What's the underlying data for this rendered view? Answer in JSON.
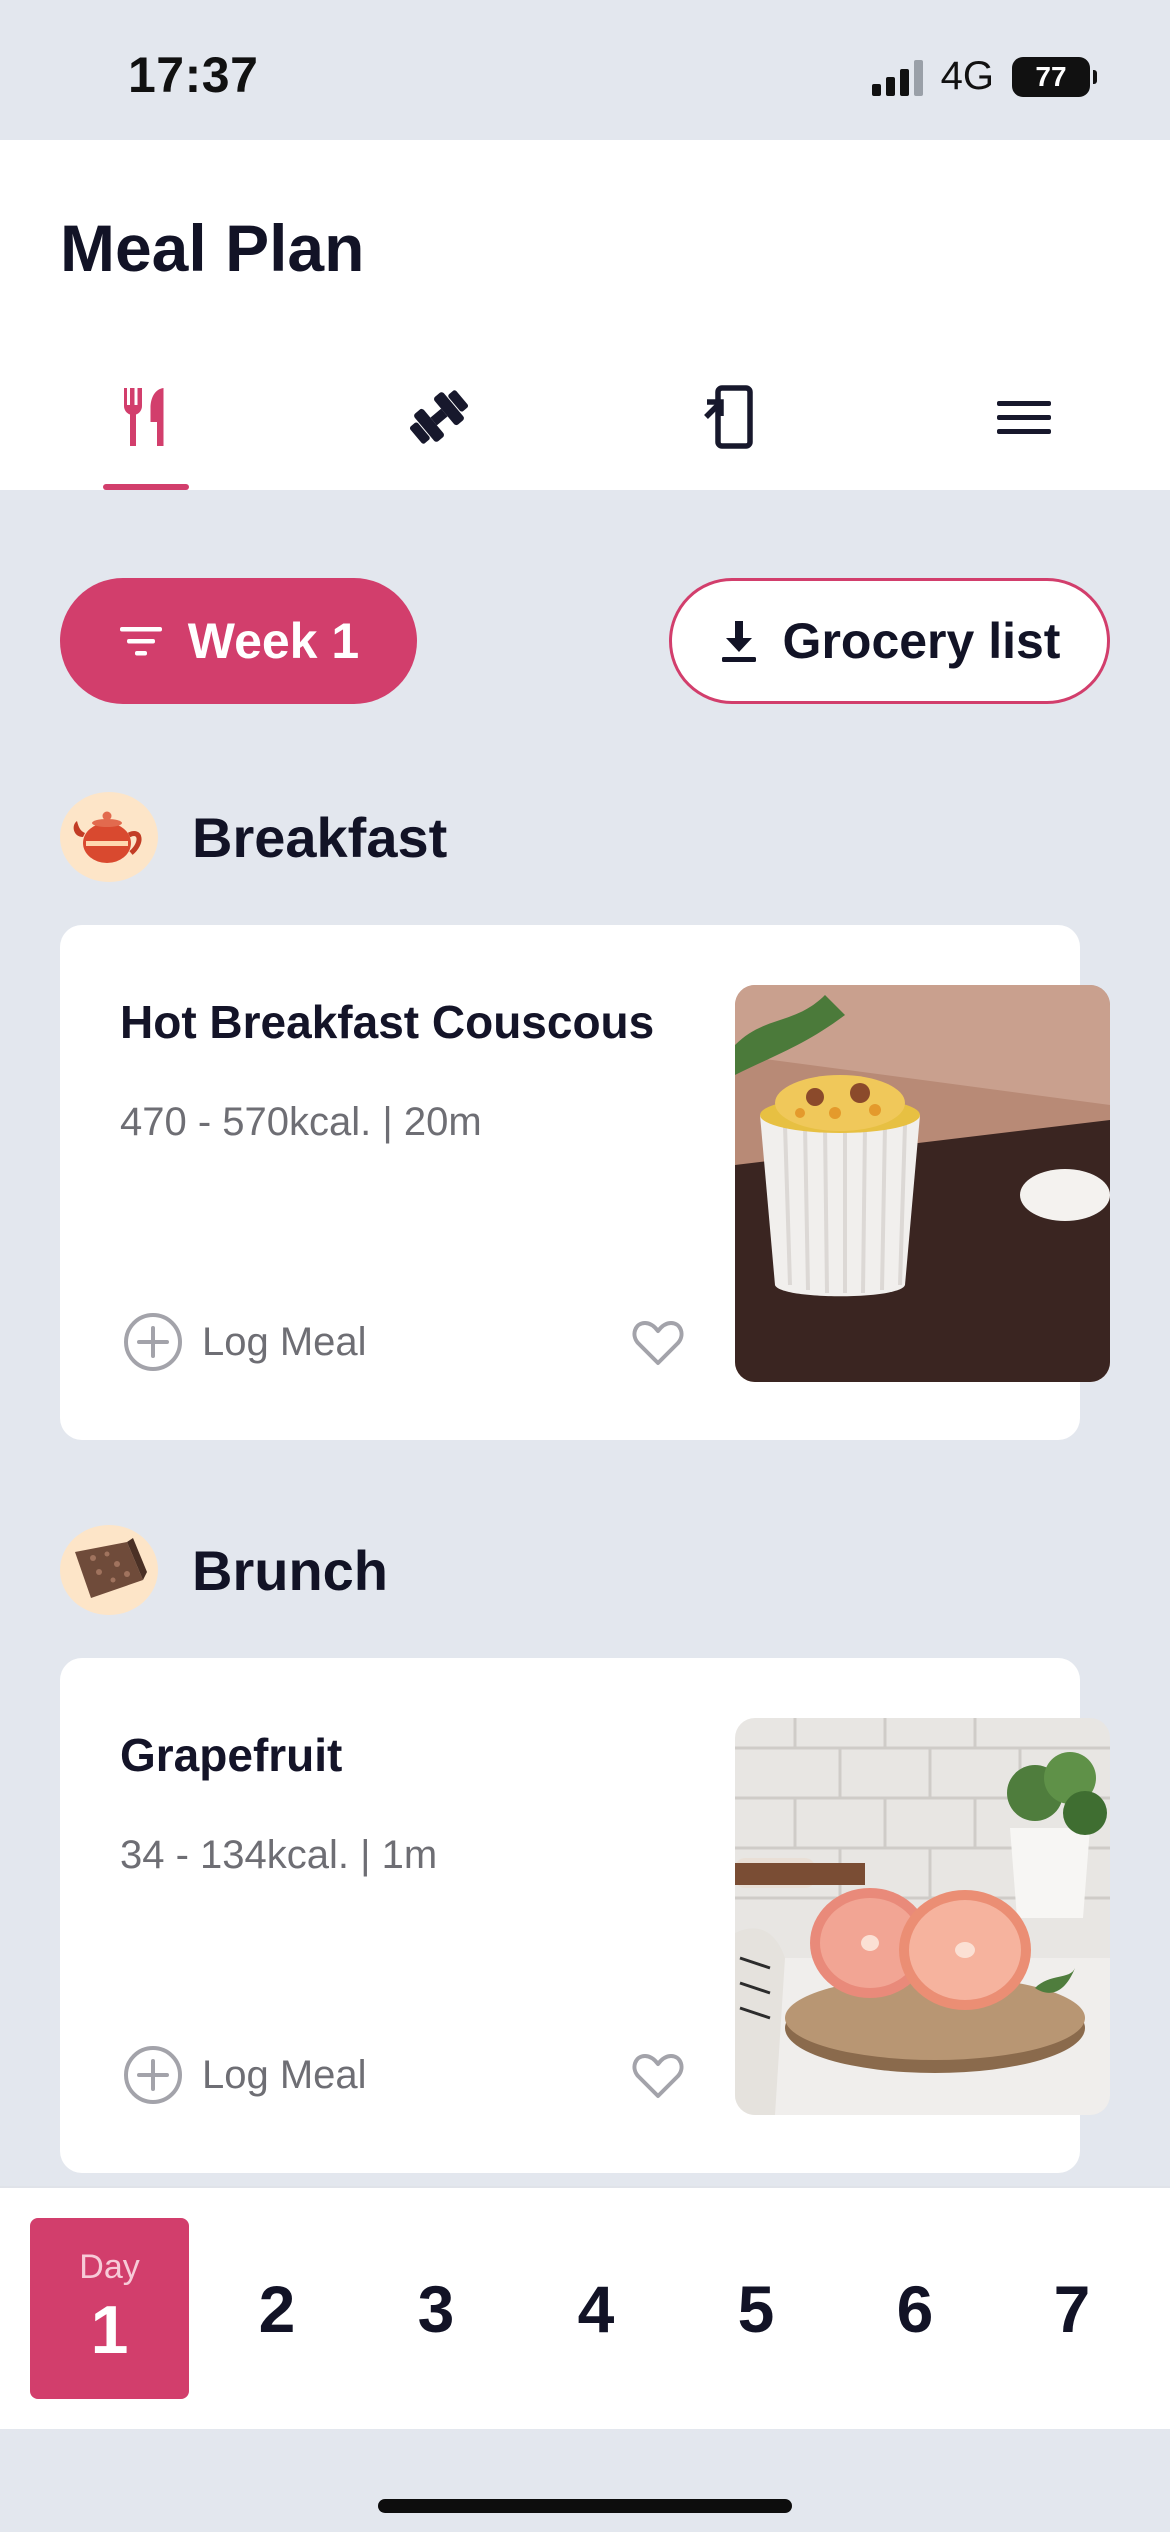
{
  "status": {
    "time": "17:37",
    "network": "4G",
    "battery": "77"
  },
  "header": {
    "title": "Meal Plan",
    "tabs": [
      {
        "icon": "fork-knife-icon",
        "active": true
      },
      {
        "icon": "dumbbell-icon",
        "active": false
      },
      {
        "icon": "phone-sync-icon",
        "active": false
      },
      {
        "icon": "hamburger-menu-icon",
        "active": false
      }
    ]
  },
  "actions": {
    "week_label": "Week 1",
    "grocery_label": "Grocery list"
  },
  "meals": [
    {
      "heading": "Breakfast",
      "icon": "teapot-icon",
      "name": "Hot Breakfast Couscous",
      "meta": "470 - 570kcal.  |  20m",
      "log_label": "Log Meal"
    },
    {
      "heading": "Brunch",
      "icon": "cereal-bar-icon",
      "name": "Grapefruit",
      "meta": "34 - 134kcal.  |  1m",
      "log_label": "Log Meal"
    }
  ],
  "days": {
    "label": "Day",
    "selected": "1",
    "others": [
      "2",
      "3",
      "4",
      "5",
      "6",
      "7"
    ]
  },
  "colors": {
    "accent": "#d23e6c",
    "background": "#e3e7ee",
    "card": "#ffffff",
    "text": "#121326",
    "muted": "#6e6e74"
  }
}
